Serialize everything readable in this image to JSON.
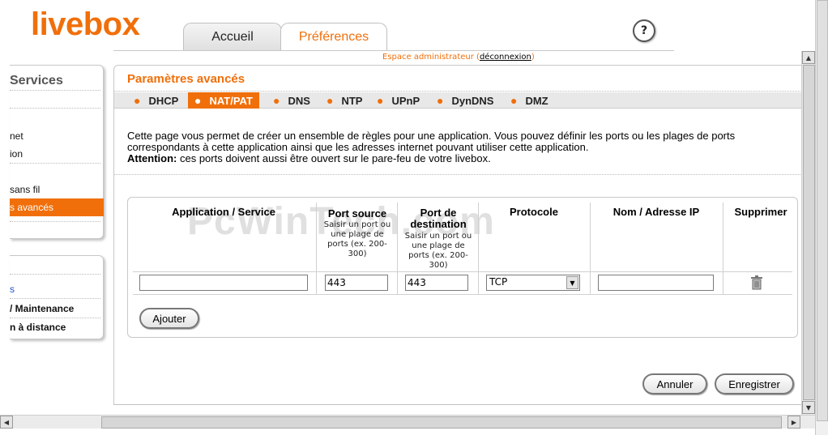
{
  "header": {
    "logo": "livebox",
    "tabs": [
      {
        "label": "Accueil"
      },
      {
        "label": "Préférences"
      }
    ],
    "admin_text": "Espace administrateur",
    "admin_open": "(",
    "logout_link": "déconnexion",
    "admin_close": ")",
    "help_symbol": "?"
  },
  "sidebar": {
    "title": "Services",
    "items": [
      {
        "label": "net"
      },
      {
        "label": "ion"
      },
      {
        "label": "sans fil"
      },
      {
        "label": "s avancés"
      }
    ],
    "items2": [
      {
        "label": "s"
      },
      {
        "label": "/ Maintenance"
      },
      {
        "label": "n à distance"
      }
    ]
  },
  "main": {
    "title": "Paramètres avancés",
    "subtabs": [
      {
        "label": "DHCP"
      },
      {
        "label": "NAT/PAT"
      },
      {
        "label": "DNS"
      },
      {
        "label": "NTP"
      },
      {
        "label": "UPnP"
      },
      {
        "label": "DynDNS"
      },
      {
        "label": "DMZ"
      }
    ],
    "active_subtab": "NAT/PAT",
    "description": "Cette page vous permet de créer un ensemble de règles pour une application. Vous pouvez définir les ports ou les plages de ports correspondants à cette application ainsi que les adresses internet pouvant utiliser cette application.",
    "attention_label": "Attention:",
    "attention_text": " ces ports doivent aussi être ouvert sur le pare-feu de votre livebox.",
    "watermark": "PcWinTech.com"
  },
  "table": {
    "headers": {
      "application": "Application / Service",
      "port_source": "Port source",
      "port_source_help": "Saisir un port ou une plage de ports (ex. 200-300)",
      "port_dest": "Port de destination",
      "port_dest_help": "Saisir un port ou une plage de ports (ex. 200-300)",
      "protocole": "Protocole",
      "nom_ip": "Nom / Adresse IP",
      "supprimer": "Supprimer"
    },
    "row": {
      "application": "",
      "port_source": "443",
      "port_dest": "443",
      "protocole": "TCP",
      "nom_ip": ""
    },
    "add_button": "Ajouter"
  },
  "actions": {
    "cancel": "Annuler",
    "save": "Enregistrer"
  },
  "colors": {
    "brand": "#f06f0a"
  }
}
